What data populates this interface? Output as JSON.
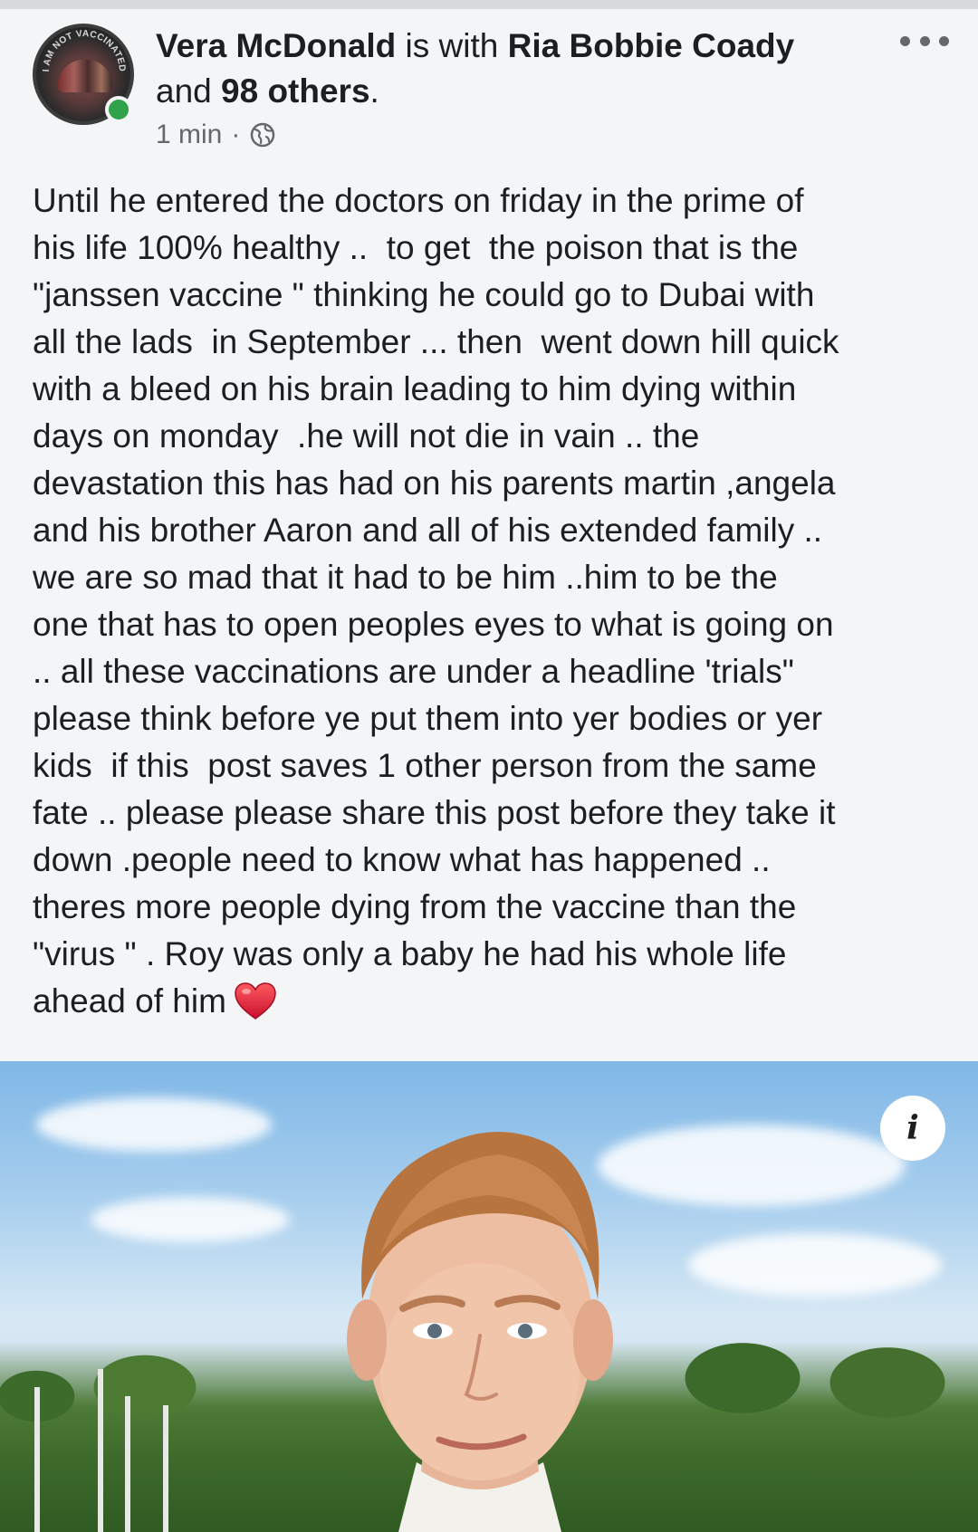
{
  "post": {
    "author": "Vera McDonald",
    "with_text": "is with",
    "tagged_primary": "Ria Bobbie Coady",
    "and_text": "and",
    "others_count": "98 others",
    "period": ".",
    "timestamp": "1 min",
    "separator": "·",
    "privacy_icon": "globe-icon",
    "more_icon": "more-options-icon",
    "body": "Until he entered the doctors on friday in the prime of\nhis life 100% healthy ..  to get  the poison that is the\n\"janssen vaccine \" thinking he could go to Dubai with\nall the lads  in September ... then  went down hill quick\nwith a bleed on his brain leading to him dying within\ndays on monday  .he will not die in vain .. the\ndevastation this has had on his parents martin ,angela\nand his brother Aaron and all of his extended family ..\nwe are so mad that it had to be him ..him to be the\none that has to open peoples eyes to what is going on\n.. all these vaccinations are under a headline 'trials\"\nplease think before ye put them into yer bodies or yer\nkids  if this  post saves 1 other person from the same\nfate .. please please share this post before they take it\ndown .people need to know what has happened ..\ntheres more people dying from the vaccine than the\n\"virus \" . Roy was only a baby he had his whole life\nahead of him",
    "emoji": "red-heart-icon"
  },
  "avatar": {
    "ring_text": "I AM NOT VACCINATED",
    "online_status_color": "#31a24c"
  },
  "photo": {
    "info_label": "i",
    "info_icon": "info-icon"
  },
  "colors": {
    "text_primary": "#1c1e21",
    "text_secondary": "#65676b",
    "background": "#f4f5f6",
    "heart": "#e0262f"
  }
}
